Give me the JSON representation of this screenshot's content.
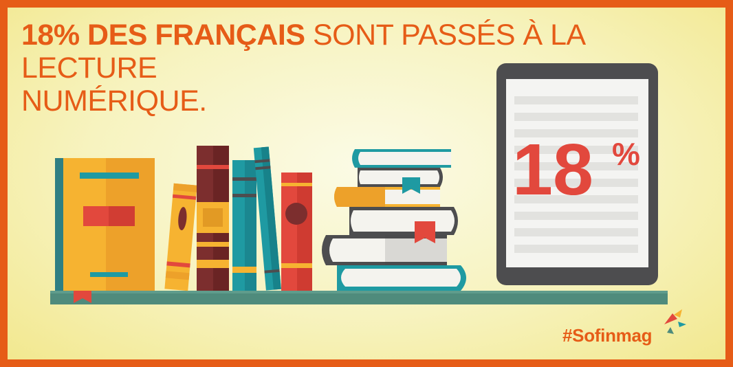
{
  "headline": {
    "bold": "18% DES FRANÇAIS",
    "regular": "SONT PASSÉS À LA LECTURE",
    "line2": "NUMÉRIQUE."
  },
  "tablet": {
    "percent_number": "18",
    "percent_sign": "%",
    "value_percent": 18
  },
  "brand": {
    "hashtag": "#Sofinmag"
  },
  "colors": {
    "frame": "#e65c17",
    "background": "#f7f3bf",
    "shelf": "#4f8b7c",
    "tablet": "#4d4d4f",
    "red": "#e2483d",
    "teal": "#1f9aa2",
    "yellow": "#f6b331",
    "maroon": "#7c2e2e"
  },
  "icons": [
    "book-icon",
    "tablet-icon",
    "bookmark-icon",
    "star-logo-icon"
  ]
}
